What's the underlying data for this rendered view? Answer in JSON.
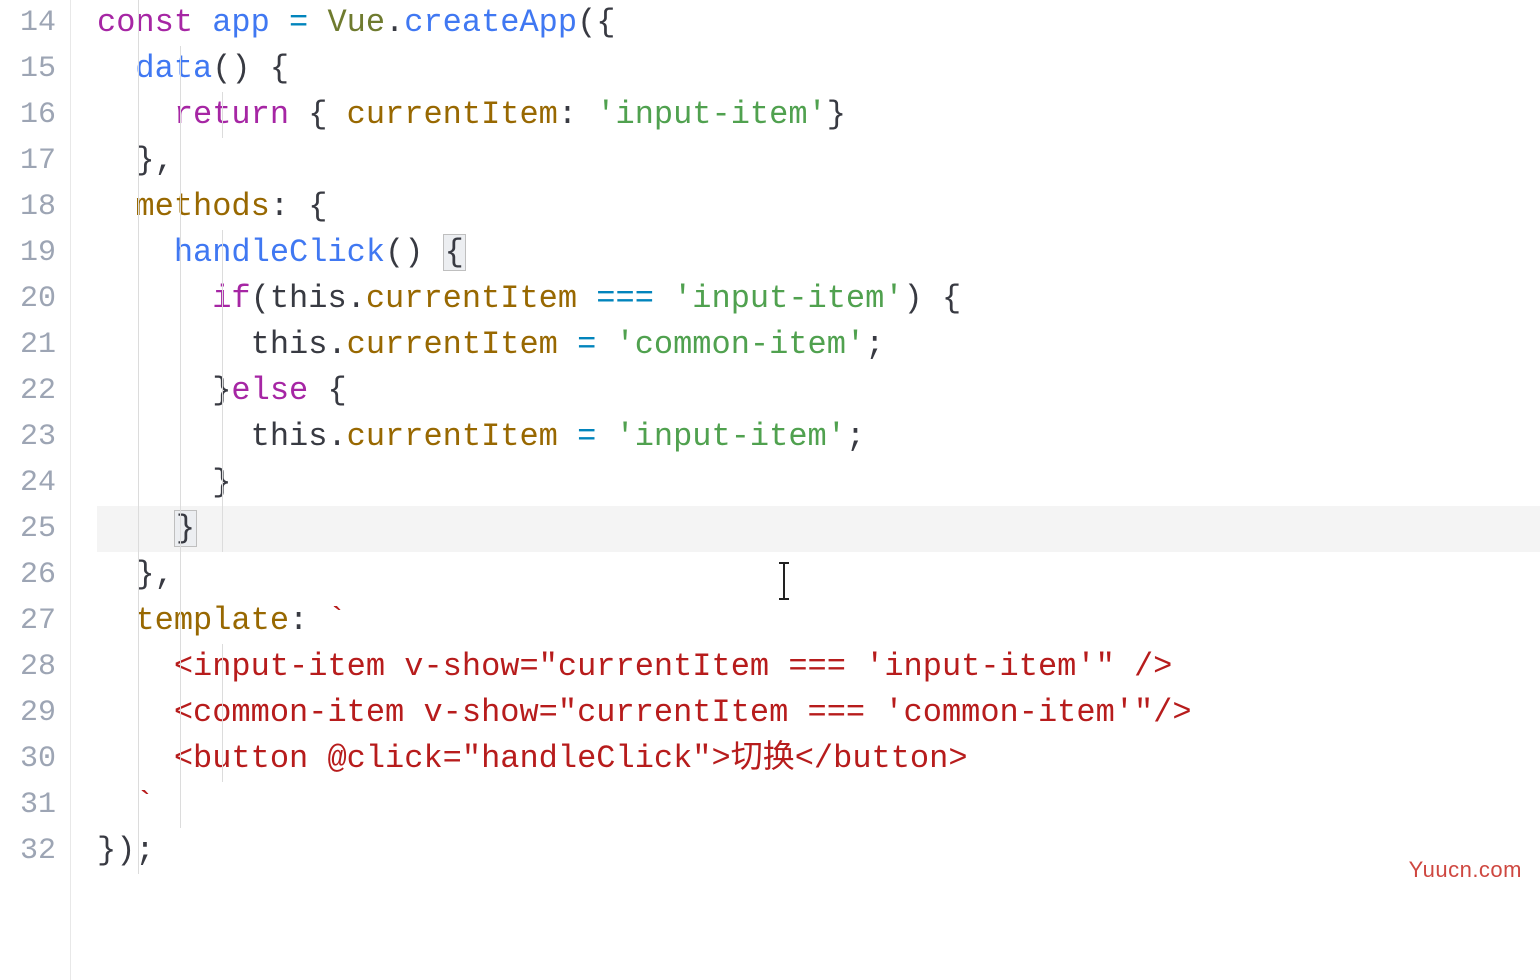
{
  "watermark": "Yuucn.com",
  "line_numbers": [
    "14",
    "15",
    "16",
    "17",
    "18",
    "19",
    "20",
    "21",
    "22",
    "23",
    "24",
    "25",
    "26",
    "27",
    "28",
    "29",
    "30",
    "31",
    "32"
  ],
  "code": {
    "l14": {
      "const": "const",
      "sp1": " ",
      "app": "app",
      "sp2": " ",
      "eq": "=",
      "sp3": " ",
      "vue": "Vue",
      "dot": ".",
      "create": "createApp",
      "open": "({"
    },
    "l15": {
      "indent": "  ",
      "data": "data",
      "paren": "()",
      "sp": " ",
      "brace": "{"
    },
    "l16": {
      "indent": "    ",
      "return": "return",
      "sp": " ",
      "ob": "{ ",
      "key": "currentItem",
      "colon": ": ",
      "val": "'input-item'",
      "cb": "}"
    },
    "l17": {
      "indent": "  ",
      "close": "},"
    },
    "l18": {
      "indent": "  ",
      "methods": "methods",
      "colon": ":",
      "sp": " ",
      "brace": "{"
    },
    "l19": {
      "indent": "    ",
      "fn": "handleClick",
      "paren": "()",
      "sp": " ",
      "brace": "{"
    },
    "l20": {
      "indent": "      ",
      "if": "if",
      "op": "(",
      "this": "this",
      "dot": ".",
      "prop": "currentItem",
      "sp1": " ",
      "eqeq": "===",
      "sp2": " ",
      "val": "'input-item'",
      "cp": ")",
      "sp3": " ",
      "brace": "{"
    },
    "l21": {
      "indent": "        ",
      "this": "this",
      "dot": ".",
      "prop": "currentItem",
      "sp1": " ",
      "eq": "=",
      "sp2": " ",
      "val": "'common-item'",
      "semi": ";"
    },
    "l22": {
      "indent": "      ",
      "cb": "}",
      "else": "else",
      "sp": " ",
      "ob": "{"
    },
    "l23": {
      "indent": "        ",
      "this": "this",
      "dot": ".",
      "prop": "currentItem",
      "sp1": " ",
      "eq": "=",
      "sp2": " ",
      "val": "'input-item'",
      "semi": ";"
    },
    "l24": {
      "indent": "      ",
      "cb": "}"
    },
    "l25": {
      "indent": "    ",
      "cb": "}"
    },
    "l26": {
      "indent": "  ",
      "close": "},"
    },
    "l27": {
      "indent": "  ",
      "template": "template",
      "colon": ":",
      "sp": " ",
      "tick": "`"
    },
    "l28": {
      "indent": "    ",
      "txt": "<input-item v-show=\"currentItem === 'input-item'\" />"
    },
    "l29": {
      "indent": "    ",
      "txt": "<common-item v-show=\"currentItem === 'common-item'\"/>"
    },
    "l30": {
      "indent": "    ",
      "txt": "<button @click=\"handleClick\">切换</button>"
    },
    "l31": {
      "indent": "  ",
      "tick": "`"
    },
    "l32": {
      "close": "});"
    }
  }
}
